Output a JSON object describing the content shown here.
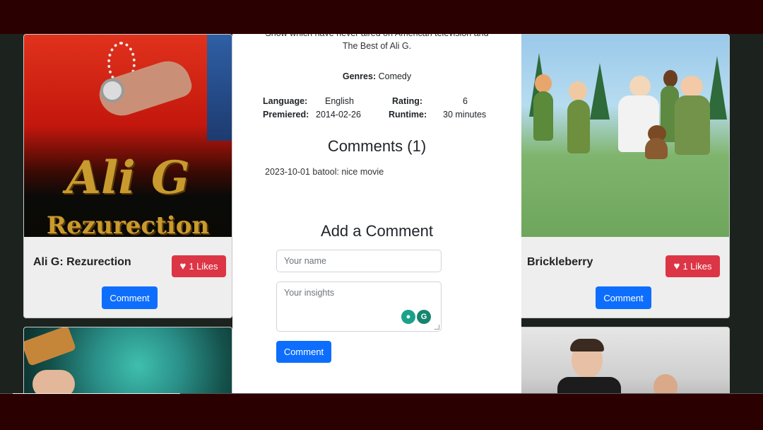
{
  "cards": [
    {
      "title": "Ali G: Rezurection",
      "likes_label": "1 Likes",
      "comment_label": "Comment",
      "poster_text_1": "Ali G",
      "poster_text_2": "Rezurection"
    },
    {
      "title": "Brickleberry",
      "likes_label": "1 Likes",
      "comment_label": "Comment"
    }
  ],
  "modal": {
    "description_cut": "Show which have never aired on American television and",
    "description_line2": "The Best of Ali G.",
    "genres_label": "Genres:",
    "genres_value": "Comedy",
    "language_label": "Language:",
    "language_value": "English",
    "rating_label": "Rating:",
    "rating_value": "6",
    "premiered_label": "Premiered:",
    "premiered_value": "2014-02-26",
    "runtime_label": "Runtime:",
    "runtime_value": "30 minutes",
    "comments_heading": "Comments (1)",
    "comments": [
      "2023-10-01 batool: nice movie"
    ],
    "add_heading": "Add a Comment",
    "name_placeholder": "Your name",
    "insights_placeholder": "Your insights",
    "submit_label": "Comment"
  },
  "colors": {
    "primary": "#0d6efd",
    "danger": "#dc3545",
    "frame": "#2b0000"
  },
  "icons": [
    "heart-icon",
    "grammarly-bulb-icon",
    "grammarly-g-icon"
  ]
}
